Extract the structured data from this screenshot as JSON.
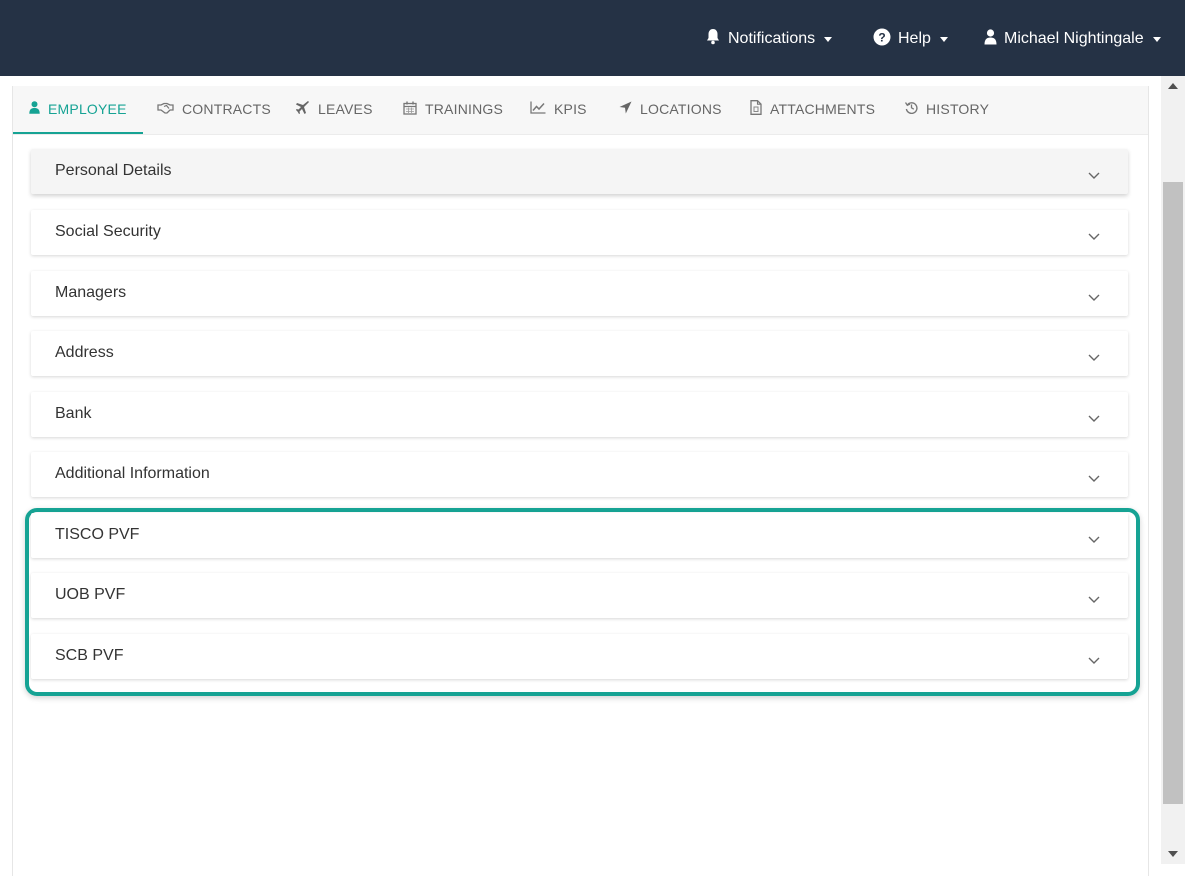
{
  "navbar": {
    "notifications_label": "Notifications",
    "help_label": "Help",
    "user_name": "Michael Nightingale"
  },
  "tabs": [
    {
      "label": "EMPLOYEE",
      "icon": "user-icon",
      "active": true
    },
    {
      "label": "CONTRACTS",
      "icon": "handshake-icon",
      "active": false
    },
    {
      "label": "LEAVES",
      "icon": "plane-icon",
      "active": false
    },
    {
      "label": "TRAININGS",
      "icon": "calendar-icon",
      "active": false
    },
    {
      "label": "KPIS",
      "icon": "line-chart-icon",
      "active": false
    },
    {
      "label": "LOCATIONS",
      "icon": "location-arrow-icon",
      "active": false
    },
    {
      "label": "ATTACHMENTS",
      "icon": "file-icon",
      "active": false
    },
    {
      "label": "HISTORY",
      "icon": "history-icon",
      "active": false
    }
  ],
  "sections": [
    {
      "title": "Personal Details"
    },
    {
      "title": "Social Security"
    },
    {
      "title": "Managers"
    },
    {
      "title": "Address"
    },
    {
      "title": "Bank"
    },
    {
      "title": "Additional Information"
    },
    {
      "title": "TISCO PVF"
    },
    {
      "title": "UOB PVF"
    },
    {
      "title": "SCB PVF"
    }
  ],
  "colors": {
    "navbar_bg": "#253245",
    "accent": "#16a394"
  }
}
